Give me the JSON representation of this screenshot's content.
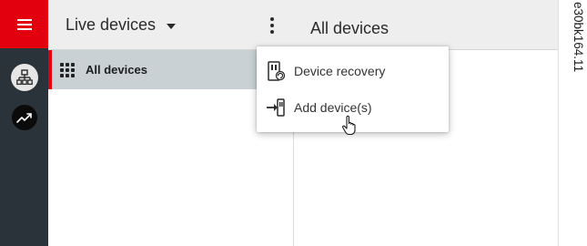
{
  "header": {
    "dropdown_label": "Live devices",
    "right_title": "All devices"
  },
  "sidebar": {
    "items": [
      {
        "label": "All devices",
        "icon": "grid-icon",
        "selected": true
      }
    ]
  },
  "rail": {
    "icons": [
      "hamburger-menu-icon",
      "device-network-icon",
      "trend-chart-icon"
    ]
  },
  "context_menu": {
    "items": [
      {
        "label": "Device recovery",
        "icon": "device-recovery-icon"
      },
      {
        "label": "Add device(s)",
        "icon": "add-device-icon"
      }
    ]
  },
  "figure_id": "e30bk164.11",
  "colors": {
    "accent": "#e2000f",
    "rail_bg": "#2a3339",
    "header_bg": "#eeeeee",
    "selected_row_bg": "#c9d1d5"
  }
}
